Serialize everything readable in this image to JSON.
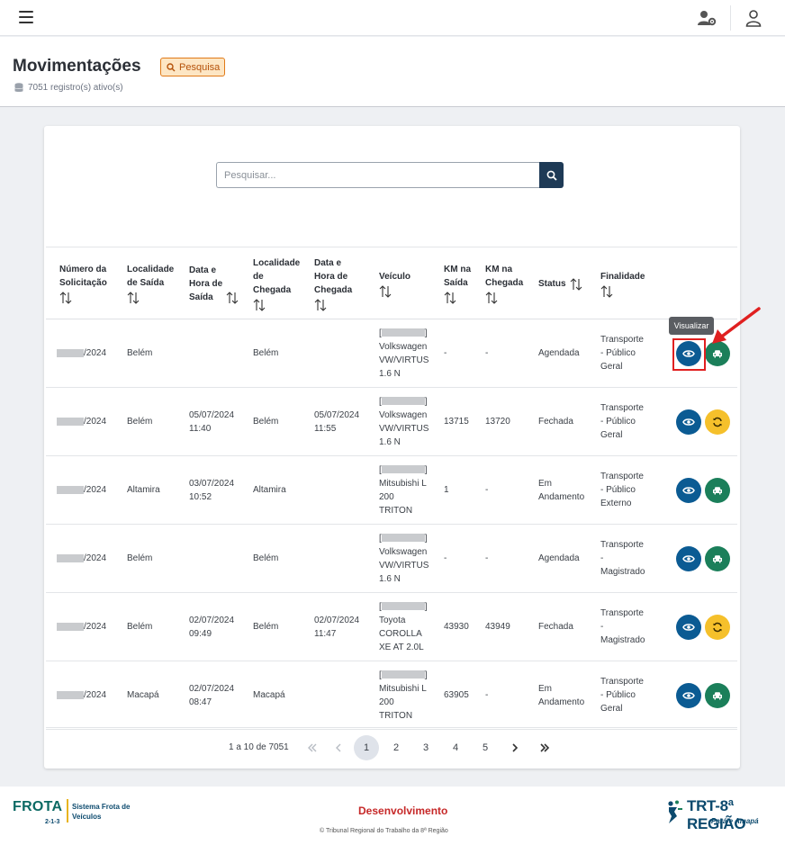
{
  "header": {
    "title": "Movimentações",
    "badge": "Pesquisa",
    "records": "7051 registro(s) ativo(s)"
  },
  "search": {
    "placeholder": "Pesquisar..."
  },
  "table": {
    "columns": [
      {
        "line1": "Número da",
        "line2": "Solicitação",
        "line3": ""
      },
      {
        "line1": "Localidade",
        "line2": "de Saída",
        "line3": ""
      },
      {
        "line1": "Data e",
        "line2": "Hora de",
        "line3": "Saída"
      },
      {
        "line1": "Localidade",
        "line2": "de",
        "line3": "Chegada"
      },
      {
        "line1": "Data e",
        "line2": "Hora de",
        "line3": "Chegada"
      },
      {
        "line1": "Veículo",
        "line2": "",
        "line3": ""
      },
      {
        "line1": "KM na",
        "line2": "Saída",
        "line3": ""
      },
      {
        "line1": "KM na",
        "line2": "Chegada",
        "line3": ""
      },
      {
        "line1": "Status",
        "line2": "",
        "line3": ""
      },
      {
        "line1": "Finalidade",
        "line2": "",
        "line3": ""
      }
    ],
    "rows": [
      {
        "num": "/2024",
        "saida": "Belém",
        "dh_saida_1": "",
        "dh_saida_2": "",
        "chegada": "Belém",
        "dh_chegada_1": "",
        "dh_chegada_2": "",
        "veic_1": "Volkswagen",
        "veic_2": "VW/VIRTUS",
        "veic_3": "1.6 N",
        "km_saida": "-",
        "km_chegada": "-",
        "status_1": "Agendada",
        "status_2": "",
        "fin_1": "Transporte",
        "fin_2": "- Público",
        "fin_3": "Geral",
        "second_action": "car"
      },
      {
        "num": "/2024",
        "saida": "Belém",
        "dh_saida_1": "05/07/2024",
        "dh_saida_2": "11:40",
        "chegada": "Belém",
        "dh_chegada_1": "05/07/2024",
        "dh_chegada_2": "11:55",
        "veic_1": "Volkswagen",
        "veic_2": "VW/VIRTUS",
        "veic_3": "1.6 N",
        "km_saida": "13715",
        "km_chegada": "13720",
        "status_1": "Fechada",
        "status_2": "",
        "fin_1": "Transporte",
        "fin_2": "- Público",
        "fin_3": "Geral",
        "second_action": "sync"
      },
      {
        "num": "/2024",
        "saida": "Altamira",
        "dh_saida_1": "03/07/2024",
        "dh_saida_2": "10:52",
        "chegada": "Altamira",
        "dh_chegada_1": "",
        "dh_chegada_2": "",
        "veic_1": "Mitsubishi L",
        "veic_2": "200",
        "veic_3": "TRITON",
        "km_saida": "1",
        "km_chegada": "-",
        "status_1": "Em",
        "status_2": "Andamento",
        "fin_1": "Transporte",
        "fin_2": "- Público",
        "fin_3": "Externo",
        "second_action": "car"
      },
      {
        "num": "/2024",
        "saida": "Belém",
        "dh_saida_1": "",
        "dh_saida_2": "",
        "chegada": "Belém",
        "dh_chegada_1": "",
        "dh_chegada_2": "",
        "veic_1": "Volkswagen",
        "veic_2": "VW/VIRTUS",
        "veic_3": "1.6 N",
        "km_saida": "-",
        "km_chegada": "-",
        "status_1": "Agendada",
        "status_2": "",
        "fin_1": "Transporte",
        "fin_2": "-",
        "fin_3": "Magistrado",
        "second_action": "car"
      },
      {
        "num": "/2024",
        "saida": "Belém",
        "dh_saida_1": "02/07/2024",
        "dh_saida_2": "09:49",
        "chegada": "Belém",
        "dh_chegada_1": "02/07/2024",
        "dh_chegada_2": "11:47",
        "veic_1": "Toyota",
        "veic_2": "COROLLA",
        "veic_3": "XE AT 2.0L",
        "km_saida": "43930",
        "km_chegada": "43949",
        "status_1": "Fechada",
        "status_2": "",
        "fin_1": "Transporte",
        "fin_2": "-",
        "fin_3": "Magistrado",
        "second_action": "sync"
      },
      {
        "num": "/2024",
        "saida": "Macapá",
        "dh_saida_1": "02/07/2024",
        "dh_saida_2": "08:47",
        "chegada": "Macapá",
        "dh_chegada_1": "",
        "dh_chegada_2": "",
        "veic_1": "Mitsubishi L",
        "veic_2": "200",
        "veic_3": "TRITON",
        "km_saida": "63905",
        "km_chegada": "-",
        "status_1": "Em",
        "status_2": "Andamento",
        "fin_1": "Transporte",
        "fin_2": "- Público",
        "fin_3": "Geral",
        "second_action": "car"
      }
    ]
  },
  "tooltip": "Visualizar",
  "pagination": {
    "info": "1 a 10 de 7051",
    "pages": [
      "1",
      "2",
      "3",
      "4",
      "5"
    ]
  },
  "footer": {
    "brand": "FROTA",
    "version": "2-1-3",
    "subtitle_1": "Sistema Frota de",
    "subtitle_2": "Veículos",
    "environment": "Desenvolvimento",
    "copyright": "© Tribunal Regional do Trabalho da 8ª Região",
    "org_name": "TRT-8ª REGIÃO",
    "org_sub": "Pará e Amapá"
  },
  "colors": {
    "primary": "#1e3a56",
    "view_button": "#0b5b93",
    "car_button": "#1b7f5a",
    "sync_button": "#f5c02b",
    "badge_border": "#e07a18",
    "highlight": "#e02020"
  },
  "icons": [
    "menu-icon",
    "user-gear-icon",
    "user-icon",
    "search-icon",
    "database-icon",
    "sort-icon",
    "eye-icon",
    "car-icon",
    "sync-icon",
    "first-page-icon",
    "prev-page-icon",
    "next-page-icon",
    "last-page-icon"
  ]
}
